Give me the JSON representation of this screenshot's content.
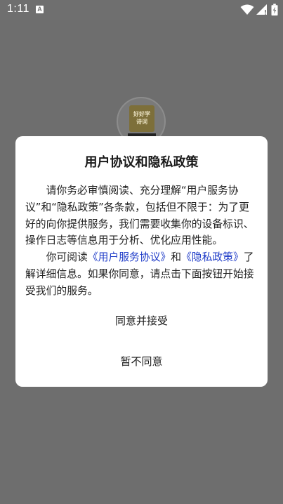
{
  "status_bar": {
    "time": "1:11",
    "notification_glyph": "A",
    "icons": [
      "wifi-icon",
      "signal-icon",
      "battery-icon"
    ]
  },
  "app_logo": {
    "line1": "好好学",
    "line2": "诗词"
  },
  "dialog": {
    "title": "用户协议和隐私政策",
    "paragraph1": "请你务必审慎阅读、充分理解“用户服务协议”和“隐私政策”各条款，包括但不限于：为了更好的向你提供服务，我们需要收集你的设备标识、操作日志等信息用于分析、优化应用性能。",
    "paragraph2_prefix": "你可阅读",
    "link_terms": "《用户服务协议》",
    "paragraph2_and": "和",
    "link_privacy": "《隐私政策》",
    "paragraph2_suffix": "了解详细信息。如果你同意，请点击下面按钮开始接受我们的服务。",
    "agree_label": "同意并接受",
    "disagree_label": "暂不同意"
  },
  "colors": {
    "overlay": "#6e6e6e",
    "link": "#1f3cc8",
    "dialog_bg": "#ffffff"
  }
}
